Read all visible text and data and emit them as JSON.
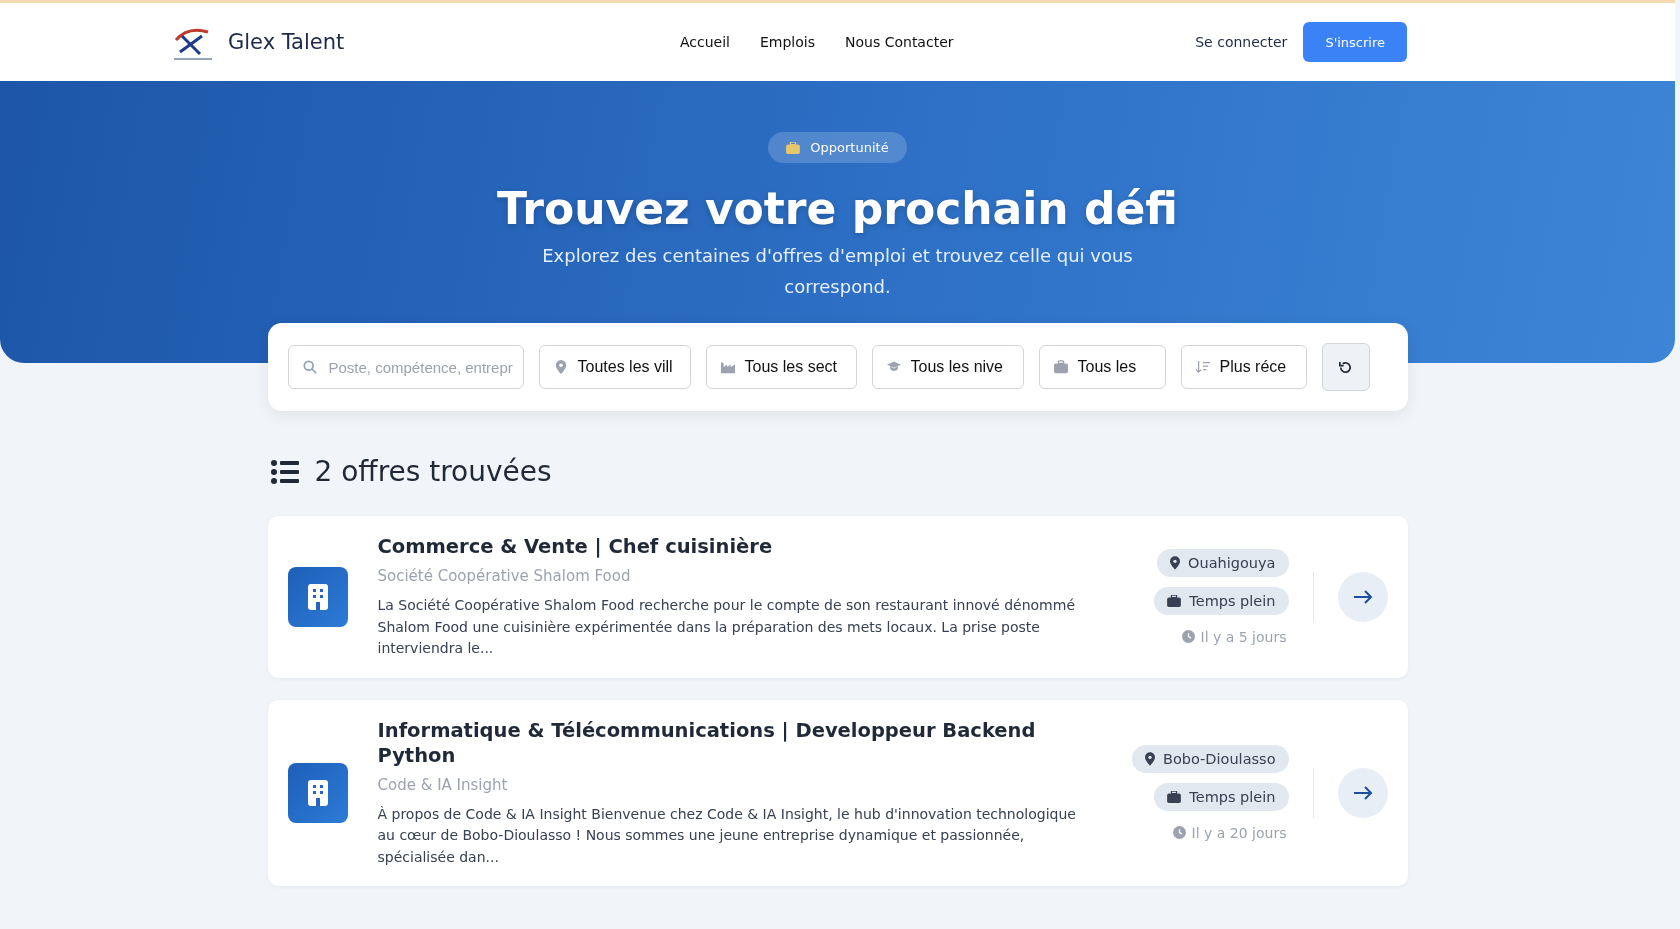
{
  "header": {
    "brand": "Glex Talent",
    "nav": [
      {
        "label": "Accueil"
      },
      {
        "label": "Emplois"
      },
      {
        "label": "Nous Contacter"
      }
    ],
    "login": "Se connecter",
    "signup": "S'inscrire"
  },
  "hero": {
    "badge": "Opportunité",
    "title": "Trouvez votre prochain défi",
    "subtitle": "Explorez des centaines d'offres d'emploi et trouvez celle qui vous correspond."
  },
  "filters": {
    "search": {
      "placeholder": "Poste, compétence, entrepr"
    },
    "selects": [
      {
        "kind": "location",
        "value": "Toutes les vill"
      },
      {
        "kind": "sector",
        "value": "Tous les sect"
      },
      {
        "kind": "level",
        "value": "Tous les nive"
      },
      {
        "kind": "contract",
        "value": "Tous les"
      },
      {
        "kind": "sort",
        "value": "Plus réce"
      }
    ]
  },
  "results": {
    "count": "2 offres trouvées"
  },
  "jobs": [
    {
      "title": "Commerce & Vente | Chef cuisinière",
      "company": "Société Coopérative Shalom Food",
      "description": "La Société Coopérative Shalom Food recherche pour le compte de son restaurant innové dénommé Shalom Food une cuisinière expérimentée dans la préparation des mets locaux. La prise poste interviendra le...",
      "location": "Ouahigouya",
      "contract": "Temps plein",
      "posted": "Il y a 5 jours"
    },
    {
      "title": "Informatique & Télécommunications | Developpeur Backend Python",
      "company": "Code & IA Insight",
      "description": "À propos de Code & IA Insight Bienvenue chez Code & IA Insight, le hub d'innovation technologique au cœur de Bobo-Dioulasso ! Nous sommes une jeune entreprise dynamique et passionnée, spécialisée dan...",
      "location": "Bobo-Dioulasso",
      "contract": "Temps plein",
      "posted": "Il y a 20 jours"
    }
  ]
}
